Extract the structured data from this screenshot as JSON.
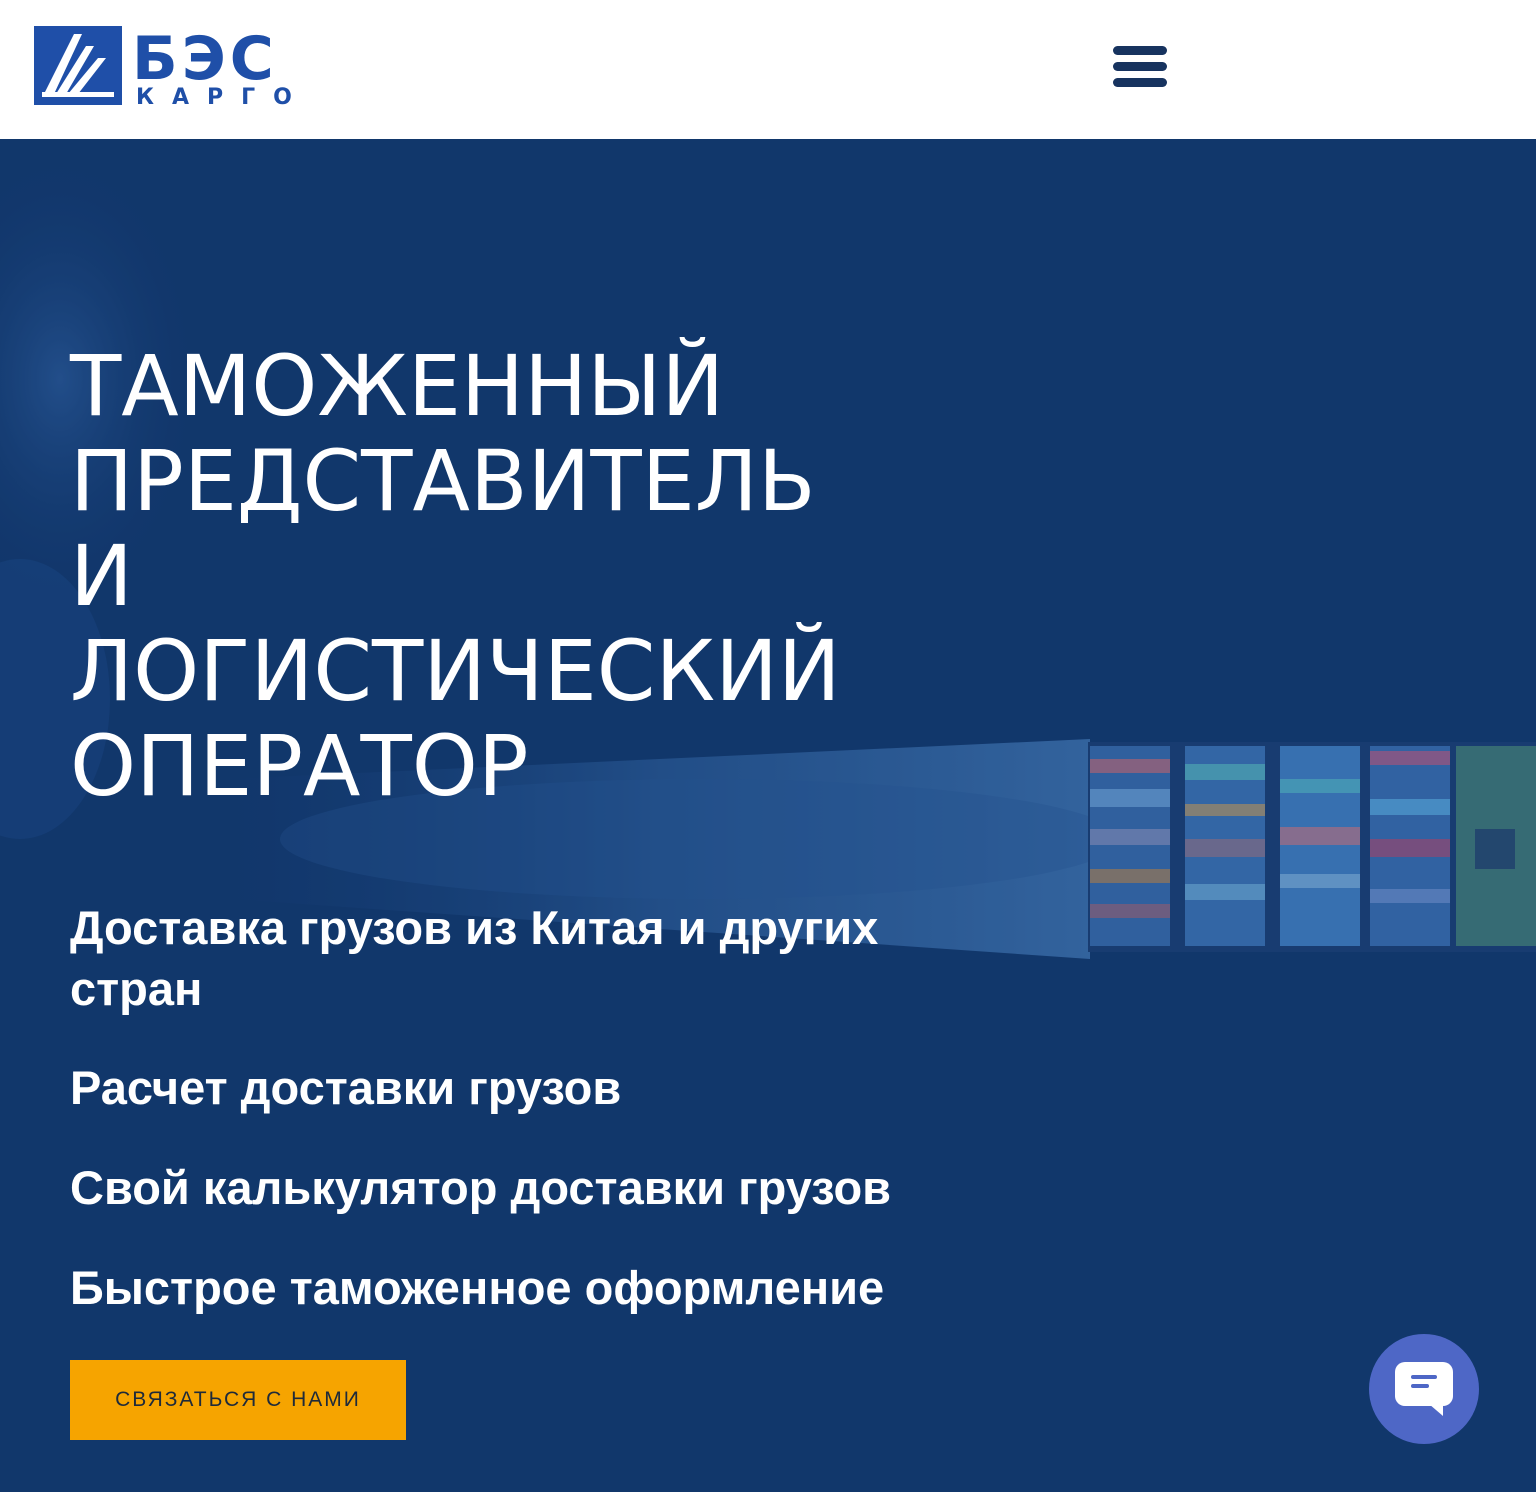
{
  "header": {
    "logo": {
      "main_text": "БЭС",
      "sub_text": "КАРГО",
      "brand_color": "#1f4fa8"
    },
    "menu_icon": "hamburger-menu-icon"
  },
  "hero": {
    "title_lines": [
      "ТАМОЖЕННЫЙ",
      "ПРЕДСТАВИТЕЛЬ",
      "И",
      "ЛОГИСТИЧЕСКИЙ",
      "ОПЕРАТОР"
    ],
    "features": [
      "Доставка грузов из Китая и других стран",
      "Расчет доставки грузов",
      "Свой калькулятор доставки грузов",
      "Быстрое таможенное оформление"
    ],
    "cta_label": "Связаться с нами",
    "background_color": "#12386d",
    "cta_color": "#f6a400"
  },
  "chat_widget": {
    "icon": "chat-bubble-icon",
    "color": "#4e67c6"
  }
}
